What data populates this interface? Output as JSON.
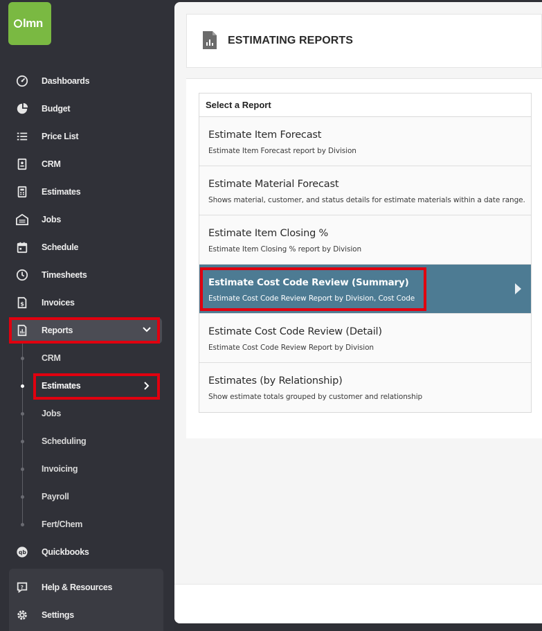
{
  "app": {
    "logo_text": "lmn"
  },
  "sidebar": {
    "items": [
      {
        "label": "Dashboards",
        "icon": "dashboard-gauge-icon"
      },
      {
        "label": "Budget",
        "icon": "pie-chart-icon"
      },
      {
        "label": "Price List",
        "icon": "list-icon"
      },
      {
        "label": "CRM",
        "icon": "contact-card-icon"
      },
      {
        "label": "Estimates",
        "icon": "calculator-icon"
      },
      {
        "label": "Jobs",
        "icon": "garage-icon"
      },
      {
        "label": "Schedule",
        "icon": "calendar-icon"
      },
      {
        "label": "Timesheets",
        "icon": "clock-icon"
      },
      {
        "label": "Invoices",
        "icon": "invoice-dollar-icon"
      },
      {
        "label": "Reports",
        "icon": "report-icon"
      }
    ],
    "reports_sub": [
      {
        "label": "CRM"
      },
      {
        "label": "Estimates"
      },
      {
        "label": "Jobs"
      },
      {
        "label": "Scheduling"
      },
      {
        "label": "Invoicing"
      },
      {
        "label": "Payroll"
      },
      {
        "label": "Fert/Chem"
      }
    ],
    "quickbooks": {
      "label": "Quickbooks",
      "icon": "quickbooks-icon"
    },
    "help": {
      "label": "Help & Resources",
      "icon": "help-chat-icon"
    },
    "settings": {
      "label": "Settings",
      "icon": "gear-icon"
    }
  },
  "page": {
    "title": "ESTIMATING REPORTS",
    "icon": "report-document-icon"
  },
  "reports": {
    "header": "Select a Report",
    "rows": [
      {
        "title": "Estimate Item Forecast",
        "desc": "Estimate Item Forecast report by Division"
      },
      {
        "title": "Estimate Material Forecast",
        "desc": "Shows material, customer, and status details for estimate materials within a date range."
      },
      {
        "title": "Estimate Item Closing %",
        "desc": "Estimate Item Closing % report by Division"
      },
      {
        "title": "Estimate Cost Code Review (Summary)",
        "desc": "Estimate Cost Code Review Report by Division, Cost Code"
      },
      {
        "title": "Estimate Cost Code Review (Detail)",
        "desc": "Estimate Cost Code Review Report by Division"
      },
      {
        "title": "Estimates (by Relationship)",
        "desc": "Show estimate totals grouped by customer and relationship"
      }
    ],
    "selected_index": 3
  },
  "colors": {
    "brand_green": "#7ab942",
    "sidebar_bg": "#303138",
    "selected_row": "#4d7b93",
    "highlight_red": "#e0000f"
  }
}
